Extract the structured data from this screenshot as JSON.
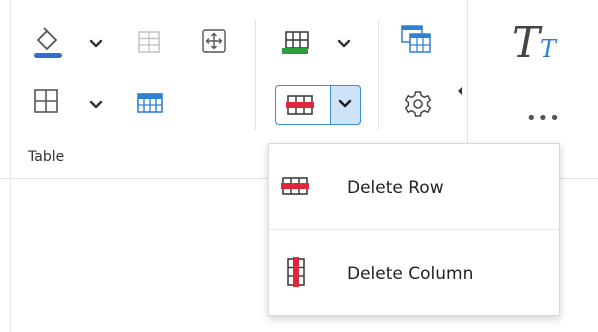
{
  "ribbon": {
    "group_label": "Table",
    "more_label": "•••",
    "styles_glyph_big": "T",
    "styles_glyph_small": "T"
  },
  "dropdown": {
    "items": [
      {
        "label": "Delete Row",
        "icon": "delete-row-icon"
      },
      {
        "label": "Delete Column",
        "icon": "delete-column-icon"
      }
    ]
  },
  "colors": {
    "accent": "#3b8fd9",
    "split_active_bg": "#cfe3f8",
    "delete_red": "#e0283a",
    "insert_green": "#2e9e3f",
    "table_blue": "#2f7fd3"
  }
}
